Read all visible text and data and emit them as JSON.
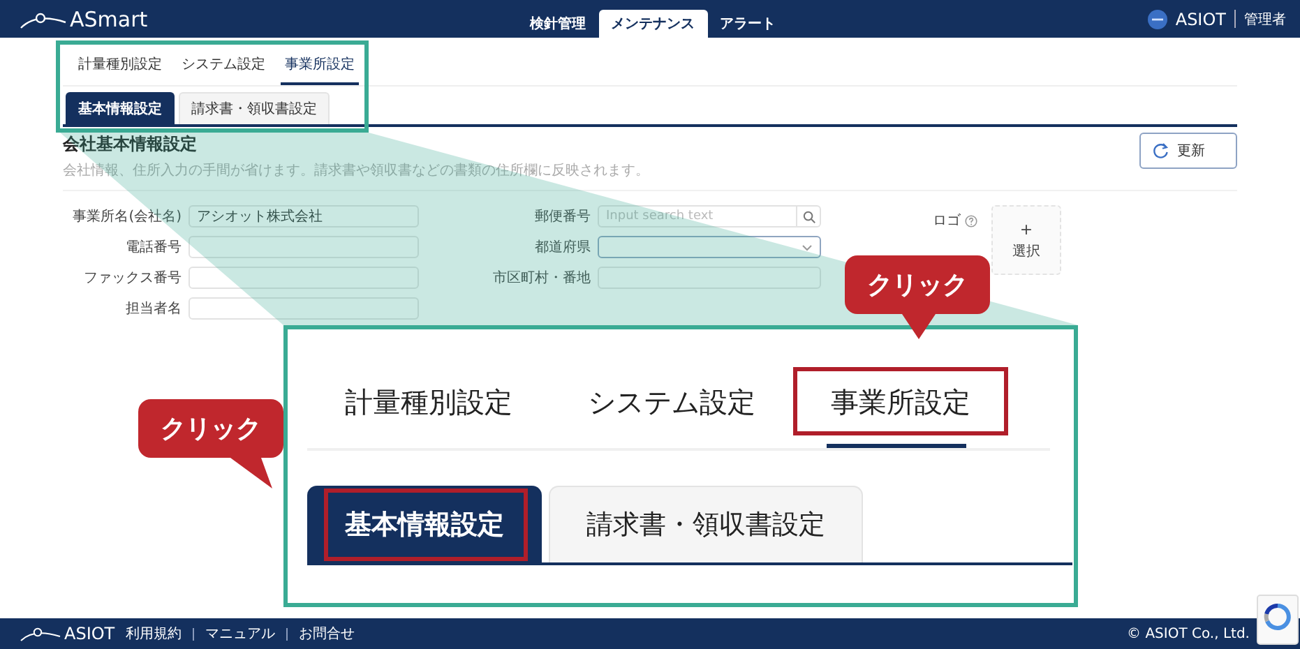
{
  "header": {
    "logo": "ASmart",
    "nav": [
      {
        "label": "検針管理",
        "selected": false
      },
      {
        "label": "メンテナンス",
        "selected": true
      },
      {
        "label": "アラート",
        "selected": false
      }
    ],
    "brand": "ASIOT",
    "user": "管理者"
  },
  "tabs": [
    {
      "label": "計量種別設定",
      "selected": false
    },
    {
      "label": "システム設定",
      "selected": false
    },
    {
      "label": "事業所設定",
      "selected": true
    }
  ],
  "subtabs": [
    {
      "label": "基本情報設定",
      "selected": true
    },
    {
      "label": "請求書・領収書設定",
      "selected": false
    }
  ],
  "section": {
    "title": "会社基本情報設定",
    "description": "会社情報、住所入力の手間が省けます。請求書や領収書などの書類の住所欄に反映されます。",
    "update_button": "更新"
  },
  "form": {
    "left": [
      {
        "label": "事業所名(会社名)",
        "kind": "text",
        "value": "アシオット株式会社"
      },
      {
        "label": "電話番号",
        "kind": "text"
      },
      {
        "label": "ファックス番号",
        "kind": "text"
      },
      {
        "label": "担当者名",
        "kind": "text"
      }
    ],
    "right": [
      {
        "label": "郵便番号",
        "kind": "search",
        "placeholder": "Input search text"
      },
      {
        "label": "都道府県",
        "kind": "select"
      },
      {
        "label": "市区町村・番地",
        "kind": "text"
      }
    ],
    "logo": {
      "label": "ロゴ",
      "sign": "+",
      "upload": "選択"
    }
  },
  "zoom": {
    "tabs": [
      {
        "label": "計量種別設定",
        "selected": false,
        "highlighted": false
      },
      {
        "label": "システム設定",
        "selected": false,
        "highlighted": false
      },
      {
        "label": "事業所設定",
        "selected": true,
        "highlighted": true
      }
    ],
    "subtabs": [
      {
        "label": "基本情報設定",
        "selected": true,
        "highlighted": true
      },
      {
        "label": "請求書・領収書設定",
        "selected": false,
        "highlighted": false
      }
    ]
  },
  "callouts": [
    "クリック",
    "クリック"
  ],
  "footer": {
    "logo": "ASIOT",
    "links": [
      "利用規約",
      "マニュアル",
      "お問合せ"
    ],
    "copyright": "© ASIOT Co., Ltd."
  }
}
